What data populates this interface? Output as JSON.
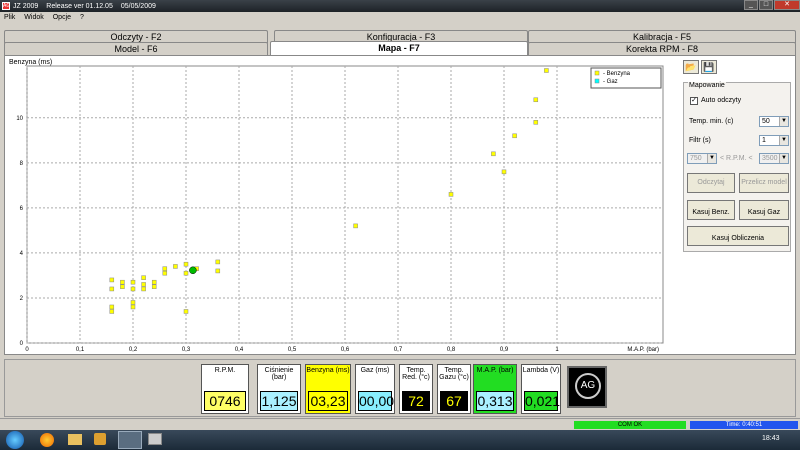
{
  "app": {
    "title": "JZ 2009",
    "release": "Release  ver 01.12.05",
    "date": "05/05/2009"
  },
  "menu": [
    "Plik",
    "Widok",
    "Opcje",
    "?"
  ],
  "tabs_row1": [
    "Odczyty - F2",
    "Konfiguracja - F3",
    "Kalibracja - F5"
  ],
  "tabs_row2": [
    "Model - F6",
    "Mapa - F7",
    "Korekta RPM - F8"
  ],
  "chart_data": {
    "type": "scatter",
    "ylabel": "Benzyna (ms)",
    "xlabel": "M.A.P. (bar)",
    "xlim": [
      0,
      1.2
    ],
    "ylim": [
      0,
      12.3
    ],
    "x_ticks": [
      0,
      0.1,
      0.2,
      0.3,
      0.4,
      0.5,
      0.6,
      0.7,
      0.8,
      0.9,
      1
    ],
    "x_tick_labels": [
      "0",
      "0,1",
      "0,2",
      "0,3",
      "0,4",
      "0,5",
      "0,6",
      "0,7",
      "0,8",
      "0,9",
      "1"
    ],
    "y_ticks": [
      0,
      2,
      4,
      6,
      8,
      10
    ],
    "y_tick_labels": [
      "0",
      "2",
      "4",
      "6",
      "8",
      "10"
    ],
    "grid": true,
    "legend_position": "top-right",
    "series": [
      {
        "name": "- Benzyna",
        "color": "#ffff00",
        "points": [
          [
            0.16,
            2.8
          ],
          [
            0.16,
            2.4
          ],
          [
            0.16,
            1.6
          ],
          [
            0.16,
            1.4
          ],
          [
            0.18,
            2.7
          ],
          [
            0.18,
            2.5
          ],
          [
            0.2,
            2.7
          ],
          [
            0.2,
            2.4
          ],
          [
            0.2,
            1.8
          ],
          [
            0.2,
            1.6
          ],
          [
            0.22,
            2.9
          ],
          [
            0.22,
            2.6
          ],
          [
            0.22,
            2.4
          ],
          [
            0.24,
            2.7
          ],
          [
            0.24,
            2.5
          ],
          [
            0.26,
            3.3
          ],
          [
            0.26,
            3.1
          ],
          [
            0.28,
            3.4
          ],
          [
            0.3,
            3.5
          ],
          [
            0.3,
            3.1
          ],
          [
            0.3,
            1.4
          ],
          [
            0.32,
            3.3
          ],
          [
            0.36,
            3.6
          ],
          [
            0.36,
            3.2
          ],
          [
            0.62,
            5.2
          ],
          [
            0.8,
            6.6
          ],
          [
            0.88,
            8.4
          ],
          [
            0.9,
            7.6
          ],
          [
            0.92,
            9.2
          ],
          [
            0.96,
            9.8
          ],
          [
            0.96,
            10.8
          ],
          [
            0.98,
            12.1
          ]
        ]
      },
      {
        "name": "- Gaz",
        "color": "#00ffff",
        "points": []
      }
    ],
    "current_point": {
      "x": 0.313,
      "y": 3.23,
      "color": "#00bb00"
    }
  },
  "sidebar": {
    "open_icon": "folder-open-icon",
    "save_icon": "floppy-disk-icon",
    "group_title": "Mapowanie",
    "auto_read_label": "Auto odczyty",
    "auto_read_checked": true,
    "temp_label": "Temp. min. (c)",
    "temp_value": "50",
    "filter_label": "Filtr (s)",
    "filter_value": "1",
    "rpm_low": "750",
    "rpm_label": "< R.P.M. <",
    "rpm_high": "3500",
    "btn_read": "Odczytaj",
    "btn_calc": "Przelicz model",
    "btn_clear_benz": "Kasuj Benz.",
    "btn_clear_gas": "Kasuj Gaz",
    "btn_clear_calc": "Kasuj Obliczenia"
  },
  "gauges": [
    {
      "label": "R.P.M.",
      "value": "0746",
      "bg": "#ffff66",
      "fg": "#000000",
      "header_bg": "#ffffff"
    },
    {
      "label": "Ciśnienie (bar)",
      "value": "1,125",
      "bg": "#aaf0ff",
      "fg": "#000000",
      "header_bg": "#ffffff"
    },
    {
      "label": "Benzyna (ms)",
      "value": "03,23",
      "bg": "#ffff00",
      "fg": "#000000",
      "header_bg": "#ffff00"
    },
    {
      "label": "Gaz (ms)",
      "value": "00,00",
      "bg": "#88eeff",
      "fg": "#000000",
      "header_bg": "#ffffff"
    },
    {
      "label": "Temp. Red. (°c)",
      "value": "72",
      "bg": "#000000",
      "fg": "#ffff00",
      "header_bg": "#ffffff"
    },
    {
      "label": "Temp. Gazu (°c)",
      "value": "67",
      "bg": "#000000",
      "fg": "#ffff00",
      "header_bg": "#ffffff"
    },
    {
      "label": "M.A.P. (bar)",
      "value": "0,313",
      "bg": "#aaf0ff",
      "fg": "#000000",
      "header_bg": "#22dd22"
    },
    {
      "label": "Lambda (V)",
      "value": "0,021",
      "bg": "#22dd22",
      "fg": "#000000",
      "header_bg": "#ffffff"
    }
  ],
  "logo": "AG",
  "status": {
    "com": "COM OK",
    "time": "Time: 0:40:51"
  },
  "taskbar": {
    "clock": "18:43",
    "apps": [
      "start-orb-icon",
      "firefox-icon",
      "folder-icon",
      "media-player-icon",
      "ag-app-icon",
      "window-icon"
    ]
  }
}
